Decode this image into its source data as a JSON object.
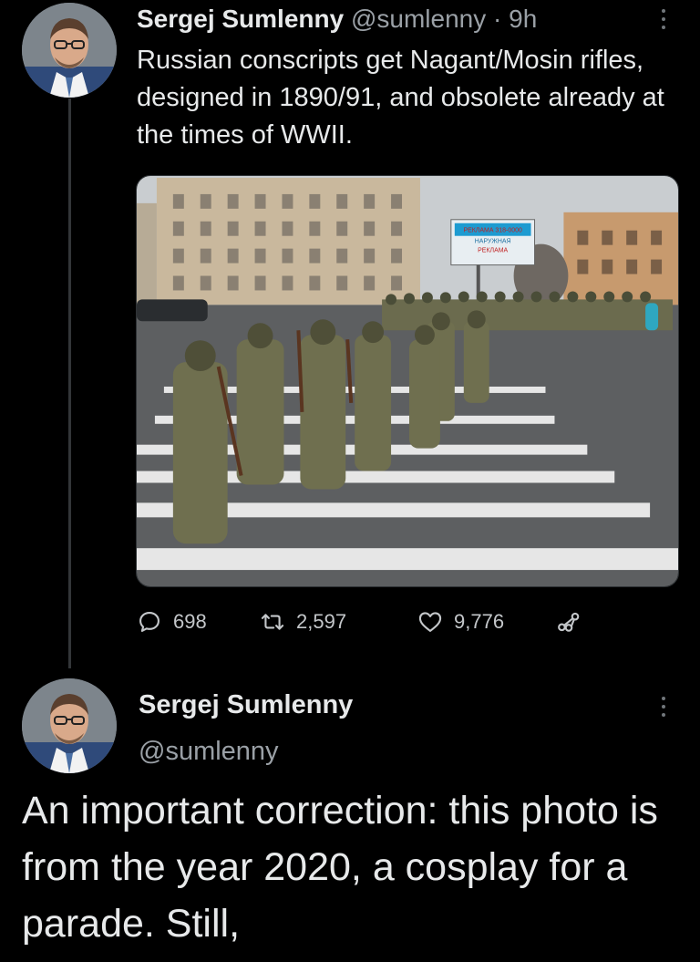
{
  "tweet": {
    "author_name": "Sergej Sumlenny",
    "handle": "@sumlenny",
    "separator": "·",
    "time": "9h",
    "text": "Russian conscripts get Nagant/Mosin rifles, designed in 1890/91, and obsolete already at the times of WWII.",
    "media": {
      "billboard_lines": [
        "РЕКЛАМА  318-0000",
        "НАРУЖНАЯ",
        "РЕКЛАМА"
      ]
    },
    "actions": {
      "replies": "698",
      "retweets": "2,597",
      "likes": "9,776"
    }
  },
  "reply": {
    "author_name": "Sergej Sumlenny",
    "handle": "@sumlenny",
    "text": "An important correction: this photo is from the year 2020, a cosplay for a parade. Still,"
  },
  "icons": {
    "reply": "speech-bubble",
    "retweet": "retweet-arrows",
    "like": "heart-outline",
    "share": "share-nodes",
    "more": "vertical-ellipsis"
  },
  "colors": {
    "background": "#000000",
    "text_primary": "#e7e9ea",
    "text_secondary": "#9aa0a6",
    "thread_line": "#333639"
  }
}
